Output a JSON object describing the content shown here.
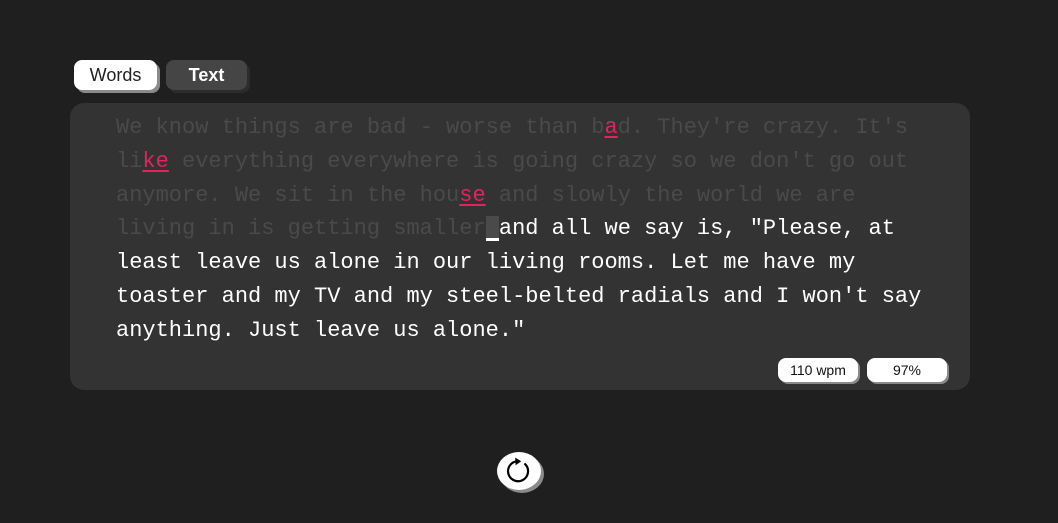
{
  "mode_tabs": {
    "words_label": "Words",
    "text_label": "Text",
    "active": "Words"
  },
  "passage": {
    "segments": [
      {
        "state": "typed",
        "text": "We know things are bad - worse than b"
      },
      {
        "state": "error",
        "text": "a"
      },
      {
        "state": "typed",
        "text": "d. They're crazy. It's li"
      },
      {
        "state": "error",
        "text": "ke"
      },
      {
        "state": "typed",
        "text": " everything everywhere is going crazy so we don't go out anymore. We sit in the hou"
      },
      {
        "state": "error",
        "text": "se"
      },
      {
        "state": "typed",
        "text": " and slowly the world we are living in is getting smaller"
      },
      {
        "state": "cursor",
        "text": " "
      },
      {
        "state": "remaining",
        "text": "and all we say is, \"Please, at least leave us alone in our living rooms. Let me have my toaster and my TV and my steel-belted radials and I won't say anything. Just leave us alone.\""
      }
    ]
  },
  "stats": {
    "wpm": "110 wpm",
    "accuracy": "97%"
  },
  "colors": {
    "background": "#1f1f1f",
    "panel": "#333333",
    "typed_text": "#4a4a4a",
    "error_text": "#e0245e",
    "remaining_text": "#ffffff"
  },
  "icons": {
    "restart": "restart-icon"
  }
}
